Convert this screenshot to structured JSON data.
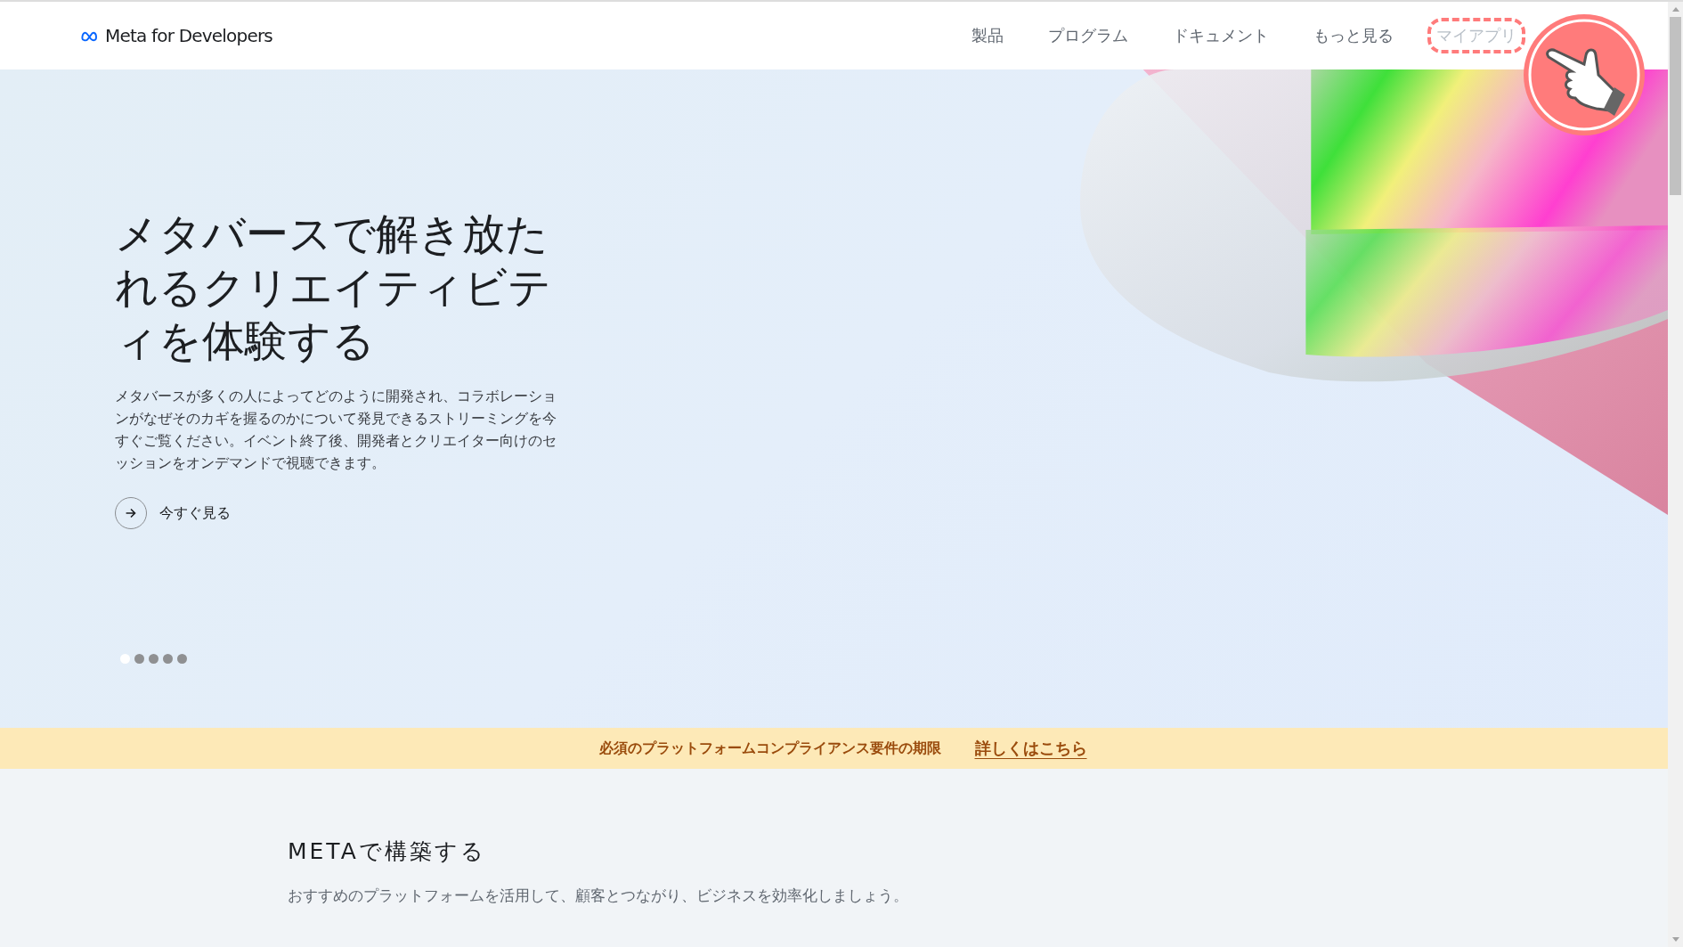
{
  "header": {
    "logo": "Meta for Developers",
    "nav": [
      {
        "label": "製品",
        "highlighted": false
      },
      {
        "label": "プログラム",
        "highlighted": false
      },
      {
        "label": "ドキュメント",
        "highlighted": false
      },
      {
        "label": "もっと見る",
        "highlighted": false
      },
      {
        "label": "マイアプリ",
        "highlighted": true
      }
    ]
  },
  "hero": {
    "title": "メタバースで解き放たれるクリエイティビティを体験する",
    "description": "メタバースが多くの人によってどのように開発され、コラボレーションがなぜそのカギを握るのかについて発見できるストリーミングを今すぐご覧ください。イベント終了後、開発者とクリエイター向けのセッションをオンデマンドで視聴できます。",
    "cta": "今すぐ見る",
    "dots": [
      {
        "selected": true
      },
      {
        "selected": false
      },
      {
        "selected": false
      },
      {
        "selected": false
      },
      {
        "selected": false
      }
    ]
  },
  "notice": {
    "text": "必須のプラットフォームコンプライアンス要件の期限",
    "link": "詳しくはこちら"
  },
  "section": {
    "title": "METAで構築する",
    "subtitle": "おすすめのプラットフォームを活用して、顧客とつながり、ビジネスを効率化しましょう。"
  }
}
